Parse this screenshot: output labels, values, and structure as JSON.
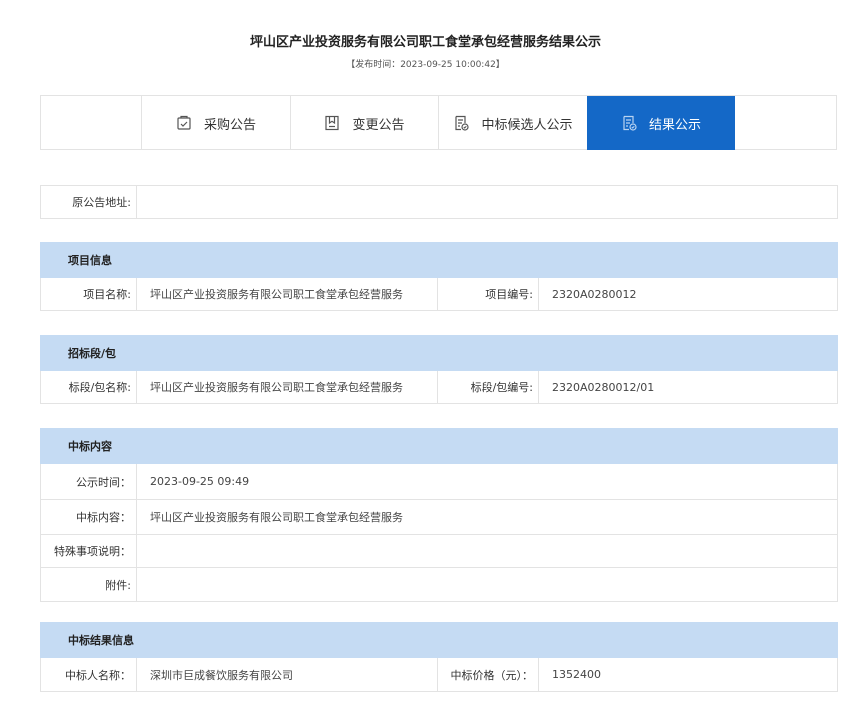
{
  "page": {
    "title": "坪山区产业投资服务有限公司职工食堂承包经营服务结果公示",
    "publish_time": "【发布时间：2023-09-25 10:00:42】"
  },
  "tabs": [
    {
      "label": "采购公告",
      "icon": "announcement-icon"
    },
    {
      "label": "变更公告",
      "icon": "bookmark-change-icon"
    },
    {
      "label": "中标候选人公示",
      "icon": "candidate-doc-icon"
    },
    {
      "label": "结果公示",
      "icon": "result-doc-icon",
      "active": true
    }
  ],
  "original_address": {
    "label": "原公告地址:",
    "value": ""
  },
  "project_info": {
    "header": "项目信息",
    "name_label": "项目名称:",
    "name_value": "坪山区产业投资服务有限公司职工食堂承包经营服务",
    "code_label": "项目编号:",
    "code_value": "2320A0280012"
  },
  "section_pkg": {
    "header": "招标段/包",
    "name_label": "标段/包名称:",
    "name_value": "坪山区产业投资服务有限公司职工食堂承包经营服务",
    "code_label": "标段/包编号:",
    "code_value": "2320A0280012/01"
  },
  "award_content": {
    "header": "中标内容",
    "time_label": "公示时间：",
    "time_value": "2023-09-25 09:49",
    "content_label": "中标内容：",
    "content_value": "坪山区产业投资服务有限公司职工食堂承包经营服务",
    "special_label": "特殊事项说明：",
    "special_value": "",
    "attach_label": "附件:",
    "attach_value": ""
  },
  "award_result": {
    "header": "中标结果信息",
    "winner_label": "中标人名称：",
    "winner_value": "深圳市巨成餐饮服务有限公司",
    "price_label": "中标价格（元）：",
    "price_value": "1352400"
  }
}
